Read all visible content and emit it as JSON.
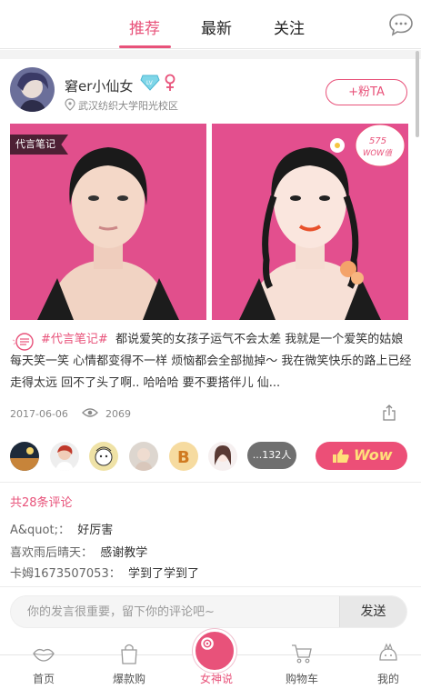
{
  "tabs": [
    {
      "label": "推荐",
      "active": true
    },
    {
      "label": "最新",
      "active": false
    },
    {
      "label": "关注",
      "active": false
    }
  ],
  "post": {
    "username": "窘er小仙女",
    "level_badge": "LV",
    "location": "武汉纺织大学阳光校区",
    "follow_label": "+粉TA",
    "photo_tag": "代言笔记",
    "wow_badge_number": "575",
    "wow_badge_text": "WOW值",
    "topic": "#代言笔记#",
    "text": "都说爱笑的女孩子运气不会太差 我就是一个爱笑的姑娘 每天笑一笑 心情都变得不一样 烦恼都会全部抛掉～ 我在微笑快乐的路上已经走得太远 回不了头了啊.. 哈哈哈 要不要搭伴儿 仙...",
    "date": "2017-06-06",
    "views": "2069",
    "liker_more": "...132人",
    "wow_button": "Wow"
  },
  "comments": {
    "count_label": "共28条评论",
    "items": [
      {
        "author": "A&quot;：",
        "text": "好厉害"
      },
      {
        "author": "喜欢雨后晴天：",
        "text": "感谢教学"
      },
      {
        "author": "卡姆1673507053：",
        "text": "学到了学到了"
      }
    ],
    "input_placeholder": "你的发言很重要，留下你的评论吧~",
    "send_label": "发送"
  },
  "bottom_nav": [
    {
      "label": "首页",
      "icon": "lips-icon"
    },
    {
      "label": "爆款购",
      "icon": "bag-icon"
    },
    {
      "label": "女神说",
      "icon": "camera-icon",
      "active": true
    },
    {
      "label": "购物车",
      "icon": "cart-icon"
    },
    {
      "label": "我的",
      "icon": "profile-icon"
    }
  ],
  "colors": {
    "accent": "#e8527a",
    "photo_bg": "#e34f8e",
    "wow_text": "#ffe07a"
  }
}
